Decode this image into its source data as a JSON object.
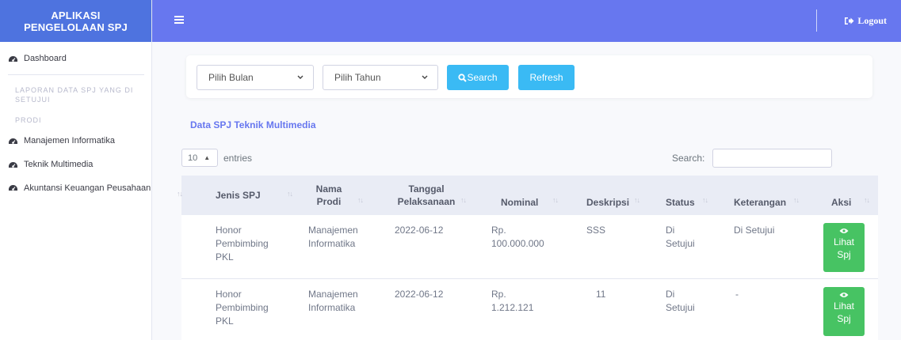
{
  "brand": {
    "line1": "APLIKASI",
    "line2": "PENGELOLAAN SPJ"
  },
  "sidebar": {
    "dashboard": "Dashboard",
    "heading_laporan": "LAPORAN DATA SPJ YANG DI SETUJUI",
    "heading_prodi": "PRODI",
    "items": [
      {
        "label": "Manajemen Informatika"
      },
      {
        "label": "Teknik Multimedia"
      },
      {
        "label": "Akuntansi Keuangan Peusahaan"
      }
    ]
  },
  "topbar": {
    "logout": "Logout"
  },
  "filter": {
    "bulan_placeholder": "Pilih Bulan",
    "tahun_placeholder": "Pilih Tahun",
    "search": "Search",
    "refresh": "Refresh"
  },
  "data_title": "Data SPJ Teknik Multimedia",
  "table_controls": {
    "entries_value": "10",
    "entries_label": "entries",
    "search_label": "Search:"
  },
  "table": {
    "headers": {
      "jenis": "Jenis SPJ",
      "nama_prodi_1": "Nama",
      "nama_prodi_2": "Prodi",
      "tanggal_1": "Tanggal",
      "tanggal_2": "Pelaksanaan",
      "nominal": "Nominal",
      "deskripsi": "Deskripsi",
      "status": "Status",
      "keterangan": "Keterangan",
      "aksi": "Aksi"
    },
    "rows": [
      {
        "jenis": [
          "Honor",
          "Pembimbing",
          "PKL"
        ],
        "prodi": [
          "Manajemen",
          "Informatika"
        ],
        "tanggal": "2022-06-12",
        "nominal": [
          "Rp.",
          "100.000.000"
        ],
        "deskripsi": "SSS",
        "status": [
          "Di",
          "Setujui"
        ],
        "keterangan": "Di Setujui",
        "aksi": [
          "Lihat",
          "Spj"
        ]
      },
      {
        "jenis": [
          "Honor",
          "Pembimbing",
          "PKL"
        ],
        "prodi": [
          "Manajemen",
          "Informatika"
        ],
        "tanggal": "2022-06-12",
        "nominal": [
          "Rp.",
          "1.212.121"
        ],
        "deskripsi": "11",
        "status": [
          "Di",
          "Setujui"
        ],
        "keterangan": "-",
        "aksi": [
          "Lihat",
          "Spj"
        ]
      }
    ]
  }
}
